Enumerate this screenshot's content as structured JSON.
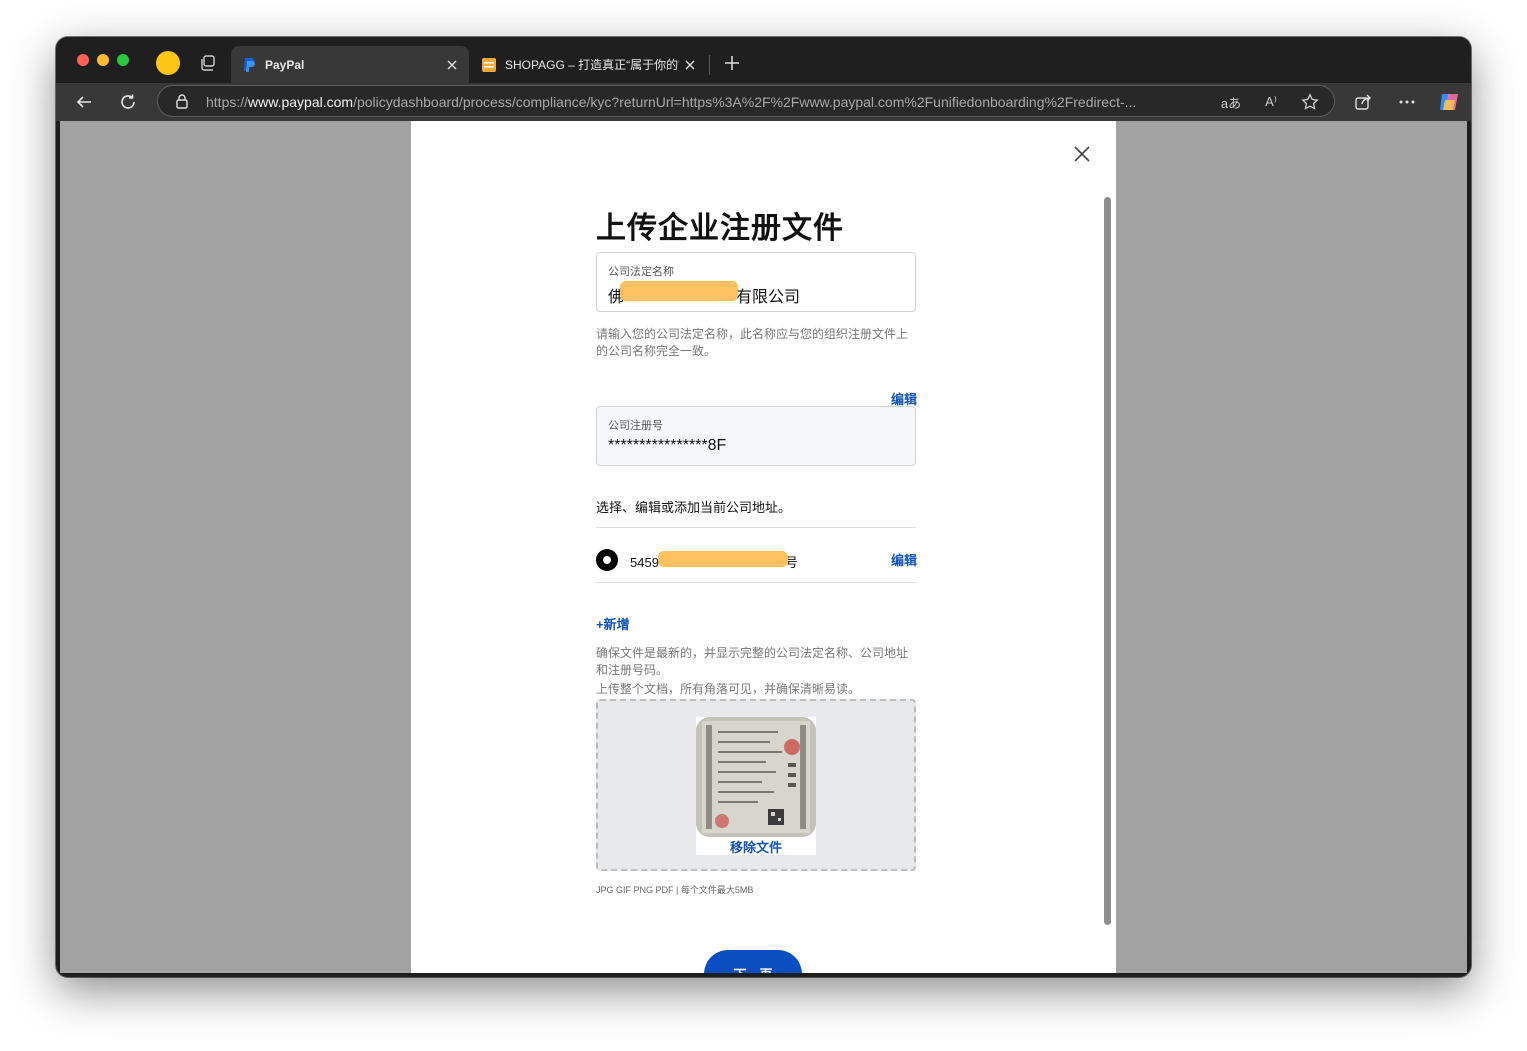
{
  "browser": {
    "tabs": [
      {
        "title": "PayPal",
        "favicon": "paypal-icon",
        "active": true
      },
      {
        "title": "SHOPAGG – 打造真正“属于你的”",
        "favicon": "shopagg-icon",
        "active": false
      }
    ],
    "url": {
      "prefix": "https://",
      "host": "www.paypal.com",
      "path": "/policydashboard/process/compliance/kyc?returnUrl=https%3A%2F%2Fwww.paypal.com%2Funifiedonboarding%2Fredirect-..."
    },
    "omnibox_icons": {
      "translate": "aあ",
      "read_aloud": "A⁾"
    }
  },
  "page": {
    "title": "上传企业注册文件",
    "legal_name": {
      "label": "公司法定名称",
      "value_start": "佛",
      "value_end": "有限公司",
      "helper": "请输入您的公司法定名称，此名称应与您的组织注册文件上的公司名称完全一致。"
    },
    "edit_label": "编辑",
    "registration": {
      "label": "公司注册号",
      "value": "****************8F"
    },
    "address_section": {
      "prompt": "选择、编辑或添加当前公司地址。",
      "address_start": "5459",
      "address_end": "号",
      "edit_label": "编辑"
    },
    "add_new": "+新增",
    "upload_helper_1": "确保文件是最新的，并显示完整的公司法定名称、公司地址和注册号码。",
    "upload_helper_2": "上传整个文档，所有角落可见，并确保清晰易读。",
    "remove_file": "移除文件",
    "formats": "JPG GIF PNG PDF | 每个文件最大5MB",
    "next_button": "下一页"
  },
  "colors": {
    "link": "#1254b6",
    "primary_button": "#0a4fc2",
    "redaction": "#ffbe59"
  }
}
